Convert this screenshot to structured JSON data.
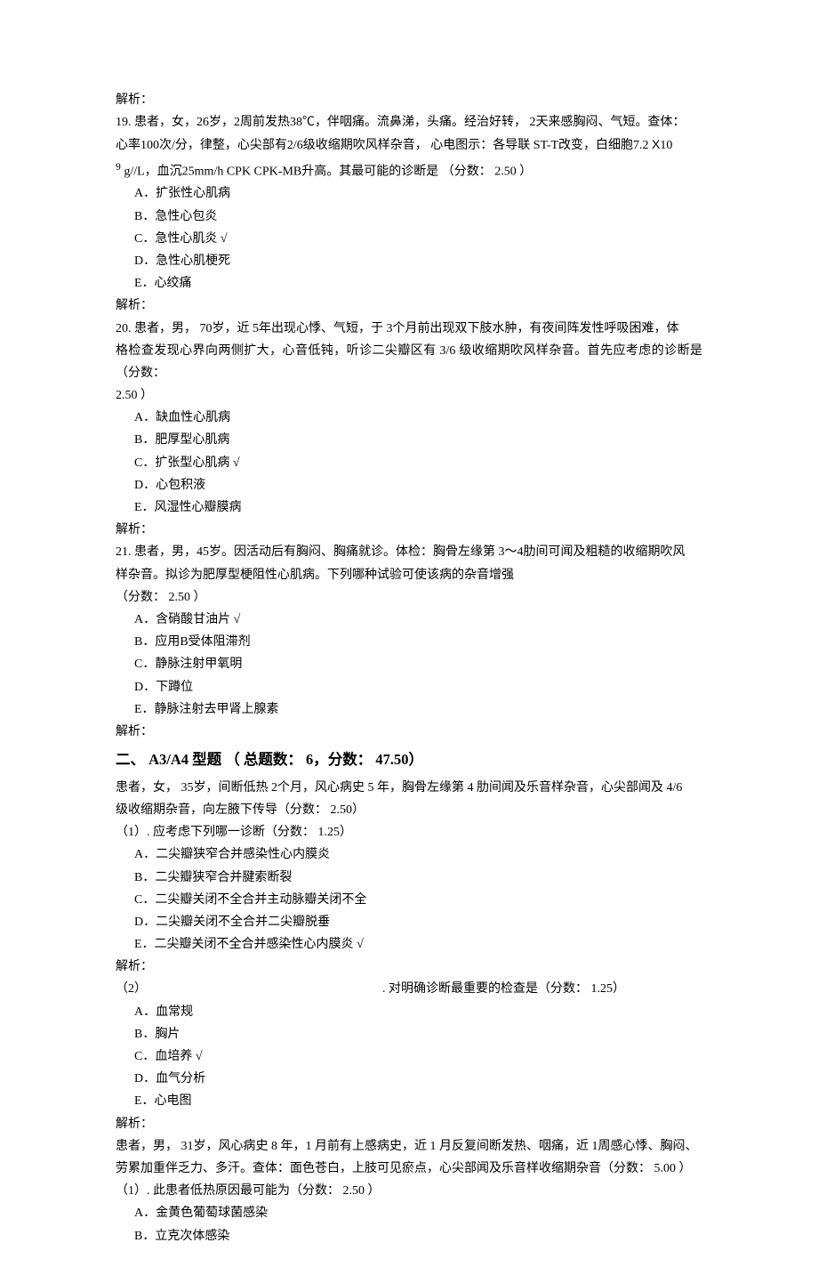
{
  "analysis_label": "解析：",
  "score_label": "（分数：",
  "score_suffix": "）",
  "tick": "√",
  "q19": {
    "line1": "19. 患者，女，26岁，2周前发热38℃，伴咽痛。流鼻涕，头痛。经治好转，      2天来感胸闷、气短。查体：",
    "line2_a": "心率100次/分，律整，心尖部有2/6级收缩期吹风样杂音，  心电图示：各导联  ST-T改变，白细胞7.2",
    "line2_b": "X",
    "line2_c": "10",
    "line3_sup": "9",
    "line3_a": " g//L，血沉25mm/h CPK CPK-MB升高。其最可能的诊断是 （分数：",
    "line3_b": "2.50",
    "line3_c": "）",
    "opts": {
      "a": "A．扩张性心肌病",
      "b": "B．急性心包炎",
      "c": "C．急性心肌炎",
      "d": "D．急性心肌梗死",
      "e": "E．心绞痛"
    }
  },
  "q20": {
    "line1": "20. 患者，男，  70岁，近  5年出现心悸、气短，于  3个月前出现双下肢水肿，有夜间阵发性呼吸困难，体",
    "line2": "格检查发现心界向两侧扩大，心音低钝，听诊二尖瓣区有 3/6 级收缩期吹风样杂音。首先应考虑的诊断是 （分数：",
    "line3": "2.50",
    "line3_suffix": "）",
    "opts": {
      "a": "A．缺血性心肌病",
      "b": "B．肥厚型心肌病",
      "c": "C．扩张型心肌病",
      "d": "D．心包积液",
      "e": "E．风湿性心瓣膜病"
    }
  },
  "q21": {
    "line1": "21. 患者，男，45岁。因活动后有胸闷、胸痛就诊。体检：胸骨左缘第        3～4肋间可闻及粗糙的收缩期吹风",
    "line2": "样杂音。拟诊为肥厚型梗阻性心肌病。下列哪种试验可使该病的杂音增强",
    "score_val": "2.50",
    "opts": {
      "a": "A．含硝酸甘油片",
      "b": "B．应用B受体阻滞剂",
      "c": "C．静脉注射甲氧明",
      "d": "D．下蹲位",
      "e": "E．静脉注射去甲肾上腺素"
    }
  },
  "section2": {
    "header": "二、  A3/A4 型题 （ 总题数：  6，分数：  47.50）"
  },
  "q_s1": {
    "stem1": "患者，女，  35岁，间断低热 2个月，风心病史  5 年，胸骨左缘第 4 肋间闻及乐音样杂音，心尖部闻及 4/6",
    "stem2": "级收缩期杂音，向左腋下传导（分数：",
    "stem2_score": "2.50）",
    "sub1": {
      "prompt": "（1）. 应考虑下列哪一诊断（分数：",
      "score": "1.25）",
      "opts": {
        "a": "A．二尖瓣狭窄合并感染性心内膜炎",
        "b": "B．二尖瓣狭窄合并腱索断裂",
        "c": "C．二尖瓣关闭不全合并主动脉瓣关闭不全",
        "d": "D．二尖瓣关闭不全合并二尖瓣脱垂",
        "e": "E．二尖瓣关闭不全合并感染性心内膜炎"
      }
    },
    "sub2": {
      "prompt_left": "（2）",
      "prompt_right": ". 对明确诊断最重要的检查是（分数：",
      "score": "1.25）",
      "opts": {
        "a": "A．血常规",
        "b": "B．胸片",
        "c": "C．血培养",
        "d": "D．血气分析",
        "e": "E．心电图"
      }
    }
  },
  "q_s2": {
    "stem1": "患者，男，  31岁，风心病史  8 年，1 月前有上感病史，近  1 月反复间断发热、咽痛，近  1周感心悸、胸闷、",
    "stem2": "劳累加重伴乏力、多汗。查体：面色苍白，上肢可见瘀点，心尖部闻及乐音样收缩期杂音（分数：",
    "stem2_score": "5.00",
    "stem2_suffix": "）",
    "sub1": {
      "prompt": "（1）. 此患者低热原因最可能为（分数：",
      "score": "2.50",
      "score_suffix": "）",
      "opts": {
        "a": "A．金黄色葡萄球菌感染",
        "b": "B．立克次体感染"
      }
    }
  }
}
